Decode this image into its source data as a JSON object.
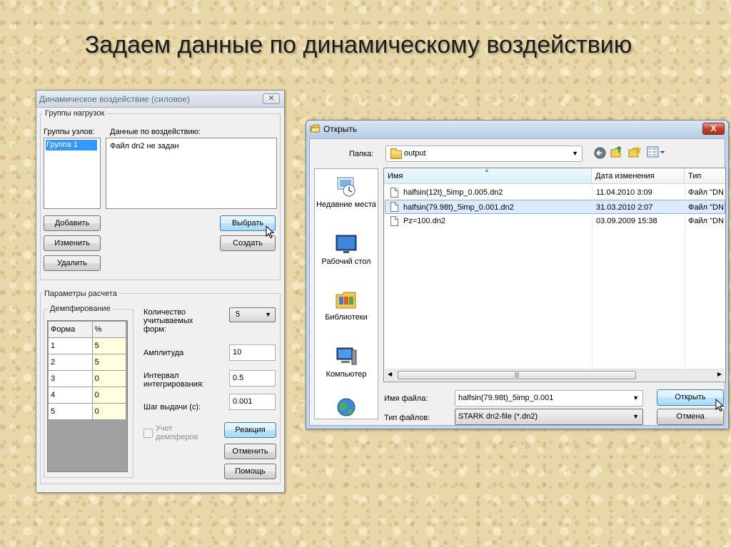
{
  "slide": {
    "title": "Задаем данные по динамическому воздействию"
  },
  "load_dialog": {
    "title": "Динамическое воздействие (силовое)",
    "close_glyph": "✕",
    "load_groups": {
      "label": "Группы нагрузок",
      "node_groups_label": "Группы узлов:",
      "node_groups": [
        "Группа 1"
      ],
      "action_data_label": "Данные по воздействию:",
      "action_data_text": "Файл dn2 не задан",
      "buttons": {
        "add": "Добавить",
        "edit": "Изменить",
        "delete": "Удалить",
        "choose": "Выбрать",
        "create": "Создать"
      }
    },
    "calc_params": {
      "label": "Параметры расчета",
      "damping_label": "Демпфирование",
      "damping_table": {
        "headers": [
          "Форма",
          "%"
        ],
        "rows": [
          [
            "1",
            "5"
          ],
          [
            "2",
            "5"
          ],
          [
            "3",
            "0"
          ],
          [
            "4",
            "0"
          ],
          [
            "5",
            "0"
          ]
        ]
      },
      "modes_count_label": "Количество учитываемых форм:",
      "modes_count": "5",
      "amplitude_label": "Амплитуда",
      "amplitude": "10",
      "integration_interval_label": "Интервал интегрирования:",
      "integration_interval": "0.5",
      "output_step_label": "Шаг выдачи (с):",
      "output_step": "0.001",
      "dampers_label": "Учет демпферов",
      "buttons": {
        "reaction": "Реакция",
        "cancel": "Отменить",
        "help": "Помощь"
      }
    }
  },
  "open_dialog": {
    "title": "Открыть",
    "close_glyph": "X",
    "folder_label": "Папка:",
    "folder": "output",
    "places": [
      "Недавние места",
      "Рабочий стол",
      "Библиотеки",
      "Компьютер",
      ""
    ],
    "columns": [
      "Имя",
      "Дата изменения",
      "Тип"
    ],
    "files": [
      {
        "name": "halfsin(12t)_5imp_0.005.dn2",
        "date": "11.04.2010 3:09",
        "type": "Файл \"DN"
      },
      {
        "name": "halfsin(79.98t)_5imp_0.001.dn2",
        "date": "31.03.2010 2:07",
        "type": "Файл \"DN"
      },
      {
        "name": "Pz=100.dn2",
        "date": "03.09.2009 15:38",
        "type": "Файл \"DN"
      }
    ],
    "filename_label": "Имя файла:",
    "filename": "halfsin(79.98t)_5imp_0.001",
    "filetype_label": "Тип файлов:",
    "filetype": "STARK dn2-file (*.dn2)",
    "buttons": {
      "open": "Открыть",
      "cancel": "Отмена"
    },
    "scroll_thumb_glyph": "|||"
  },
  "colors": {
    "selection": "#3399ff",
    "grid_value_bg": "#ffffe0",
    "close_red": "#c4412d",
    "titlebar": "#c4d6ea"
  }
}
